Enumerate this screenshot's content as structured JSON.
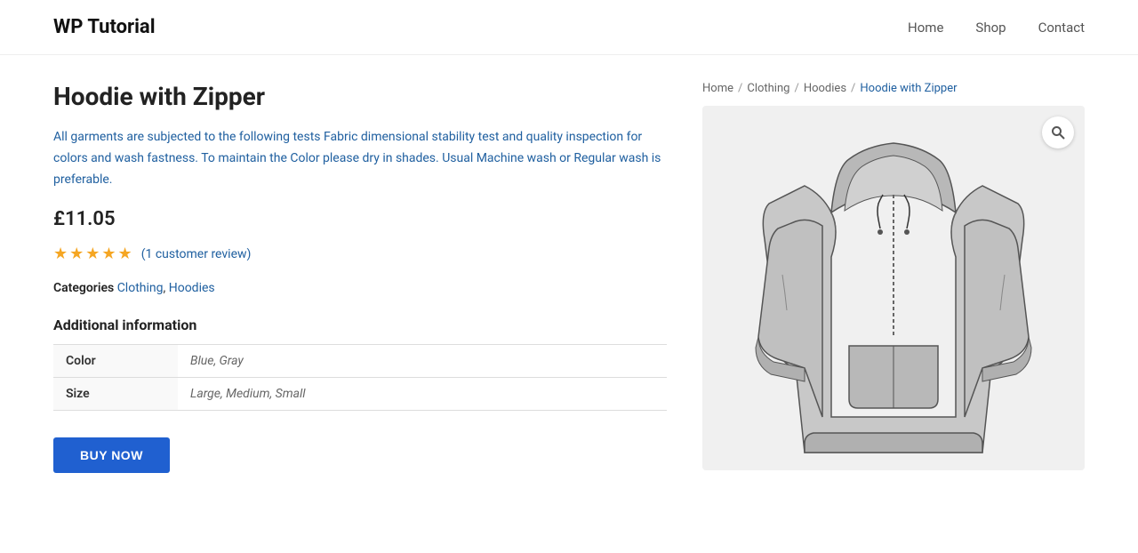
{
  "header": {
    "site_title": "WP Tutorial",
    "nav": [
      {
        "label": "Home",
        "href": "#"
      },
      {
        "label": "Shop",
        "href": "#"
      },
      {
        "label": "Contact",
        "href": "#"
      }
    ]
  },
  "breadcrumb": {
    "items": [
      {
        "label": "Home",
        "href": "#"
      },
      {
        "label": "Clothing",
        "href": "#"
      },
      {
        "label": "Hoodies",
        "href": "#"
      },
      {
        "label": "Hoodie with Zipper",
        "href": "#",
        "current": true
      }
    ]
  },
  "product": {
    "title": "Hoodie with Zipper",
    "description": "All garments are subjected to the following tests Fabric dimensional stability test and quality inspection for colors and wash fastness. To maintain the Color please dry in shades. Usual Machine wash or Regular wash is preferable.",
    "price": "£11.05",
    "rating_stars": "★★★★★",
    "review_text": "(1 customer review)",
    "categories_label": "Categories",
    "categories": [
      {
        "label": "Clothing",
        "href": "#"
      },
      {
        "label": "Hoodies",
        "href": "#"
      }
    ],
    "additional_info_title": "Additional information",
    "attributes": [
      {
        "name": "Color",
        "value": "Blue, Gray"
      },
      {
        "name": "Size",
        "value": "Large, Medium, Small"
      }
    ],
    "buy_now_label": "BUY NOW"
  }
}
